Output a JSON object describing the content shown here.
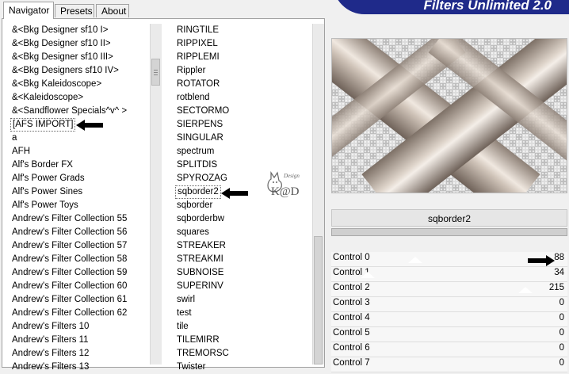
{
  "tabs": [
    {
      "label": "Navigator",
      "active": true
    },
    {
      "label": "Presets",
      "active": false
    },
    {
      "label": "About",
      "active": false
    }
  ],
  "banner": {
    "title": "Filters Unlimited 2.0"
  },
  "categories": [
    "&<Bkg Designer sf10 I>",
    "&<Bkg Designer sf10 II>",
    "&<Bkg Designer sf10 III>",
    "&<Bkg Designers sf10 IV>",
    "&<Bkg Kaleidoscope>",
    "&<Kaleidoscope>",
    "&<Sandflower Specials^v^ >",
    "[AFS IMPORT]",
    "a",
    "AFH",
    "Alf's Border FX",
    "Alf's Power Grads",
    "Alf's Power Sines",
    "Alf's Power Toys",
    "Andrew's Filter Collection 55",
    "Andrew's Filter Collection 56",
    "Andrew's Filter Collection 57",
    "Andrew's Filter Collection 58",
    "Andrew's Filter Collection 59",
    "Andrew's Filter Collection 60",
    "Andrew's Filter Collection 61",
    "Andrew's Filter Collection 62",
    "Andrew's Filters 10",
    "Andrew's Filters 11",
    "Andrew's Filters 12",
    "Andrew's Filters 13"
  ],
  "selected_category": "[AFS IMPORT]",
  "filters": [
    "RINGTILE",
    "RIPPIXEL",
    "RIPPLEMI",
    "Rippler",
    "ROTATOR",
    "rotblend",
    "SECTORMO",
    "SIERPENS",
    "SINGULAR",
    "spectrum",
    "SPLITDIS",
    "SPYROZAG",
    "sqborder2",
    "sqborder",
    "sqborderbw",
    "squares",
    "STREAKER",
    "STREAKMI",
    "SUBNOISE",
    "SUPERINV",
    "swirl",
    "test",
    "tile",
    "TILEMIRR",
    "TREMORSC",
    "Twister"
  ],
  "selected_filter": "sqborder2",
  "logo_text": "K@D",
  "logo_caption": "Design",
  "filter_title": "sqborder2",
  "progress": 1.0,
  "controls": [
    {
      "label": "Control 0",
      "value": "88",
      "level": 88
    },
    {
      "label": "Control 1",
      "value": "34",
      "level": 34
    },
    {
      "label": "Control 2",
      "value": "215",
      "level": 215
    },
    {
      "label": "Control 3",
      "value": "0",
      "level": 0
    },
    {
      "label": "Control 4",
      "value": "0",
      "level": 0
    },
    {
      "label": "Control 5",
      "value": "0",
      "level": 0
    },
    {
      "label": "Control 6",
      "value": "0",
      "level": 0
    },
    {
      "label": "Control 7",
      "value": "0",
      "level": 0
    }
  ],
  "colors": {
    "banner": "#1f2a8a",
    "ribbon_light": "#e4d9cf",
    "ribbon_dark": "#7d7066"
  }
}
